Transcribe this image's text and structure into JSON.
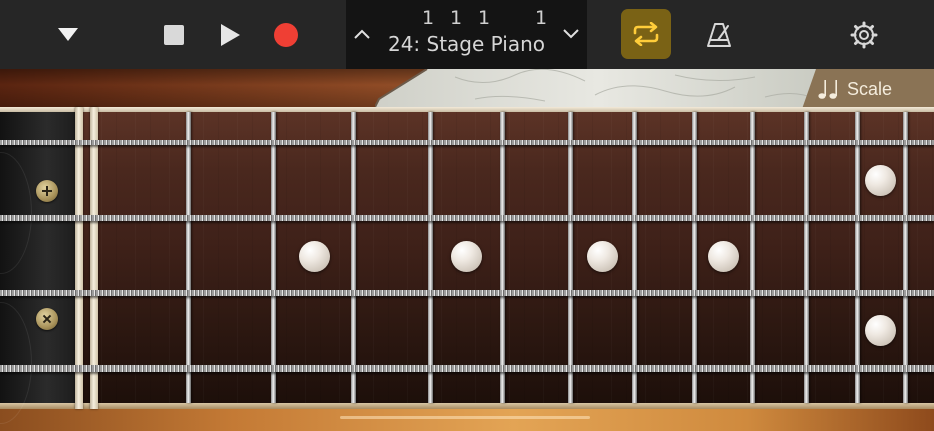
{
  "toolbar": {
    "position": {
      "bar": "1",
      "beat": "1",
      "div": "1",
      "tick": "1"
    },
    "instrument": "24: Stage Piano",
    "loop_active": true,
    "accent_color": "#ef3f34",
    "loop_bg": "#7a6215",
    "loop_icon_color": "#ffcd3a"
  },
  "controls": {
    "menu_icon": "triangle-down-icon",
    "stop_icon": "stop-icon",
    "play_icon": "play-icon",
    "record_icon": "record-icon",
    "metronome_icon": "metronome-icon",
    "settings_icon": "gear-icon"
  },
  "scale_button": {
    "label": "Scale",
    "icon": "music-notes-icon"
  },
  "fretboard": {
    "string_count": 4,
    "fret_count": 14,
    "inlay_frets": [
      3,
      5,
      7,
      9,
      12
    ],
    "double_inlay_frets": [
      12
    ]
  }
}
